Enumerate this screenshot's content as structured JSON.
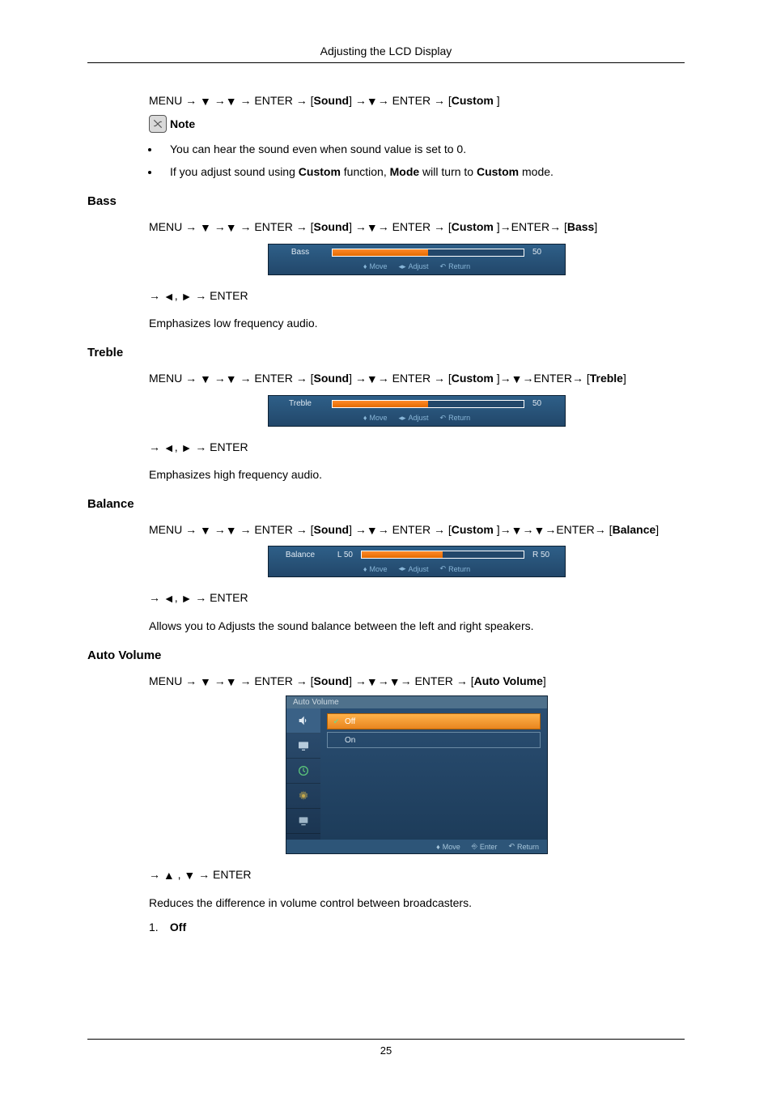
{
  "header": {
    "title": "Adjusting the LCD Display"
  },
  "glyph": {
    "down": "▼",
    "up": "▲",
    "left": "◄",
    "right": "►",
    "arrow": "→"
  },
  "intro": {
    "path_plain": "MENU → ▼ →▼ → ENTER → [Sound] →▼→ ENTER → [Custom ]",
    "note_label": "Note",
    "bullets": [
      "You can hear the sound even when sound value is set to 0.",
      "If you adjust sound using Custom function, Mode will turn to Custom mode."
    ]
  },
  "sections": {
    "bass": {
      "heading": "Bass",
      "path": "MENU → ▼ →▼ → ENTER → [Sound] →▼→ ENTER → [Custom ]→ENTER→ [Bass]",
      "osd": {
        "label": "Bass",
        "value": "50",
        "fill": "50%",
        "pre": "",
        "post": "50"
      },
      "path2": "→ ◄, ► → ENTER",
      "desc": "Emphasizes low frequency audio."
    },
    "treble": {
      "heading": "Treble",
      "path": "MENU → ▼ →▼ → ENTER → [Sound] →▼→ ENTER → [Custom ]→▼→ENTER→ [Treble]",
      "osd": {
        "label": "Treble",
        "value": "50",
        "fill": "50%",
        "pre": "",
        "post": "50"
      },
      "path2": "→ ◄, ► → ENTER",
      "desc": "Emphasizes high frequency audio."
    },
    "balance": {
      "heading": "Balance",
      "path": "MENU → ▼ →▼ → ENTER → [Sound] →▼→ ENTER → [Custom ]→▼→▼→ENTER→ [Balance]",
      "osd": {
        "label": "Balance",
        "value": "50",
        "fill": "50%",
        "pre": "L 50",
        "post": "R 50"
      },
      "path2": "→ ◄, ► → ENTER",
      "desc": "Allows you to Adjusts the sound balance between the left and right speakers."
    },
    "auto_volume": {
      "heading": "Auto Volume",
      "path": "MENU → ▼ →▼ → ENTER → [Sound] →▼→▼→ ENTER → [Auto Volume]",
      "menu": {
        "title": "Auto Volume",
        "options": [
          "Off",
          "On"
        ],
        "selected_index": 0,
        "footer": {
          "move": "Move",
          "enter": "Enter",
          "ret": "Return"
        }
      },
      "path2": "→ ▲ , ▼ → ENTER",
      "desc": "Reduces the difference in volume control between broadcasters.",
      "list": [
        {
          "n": "1.",
          "label": "Off"
        }
      ]
    }
  },
  "osd_footer": {
    "move": "Move",
    "adjust": "Adjust",
    "ret": "Return"
  },
  "page_number": "25"
}
